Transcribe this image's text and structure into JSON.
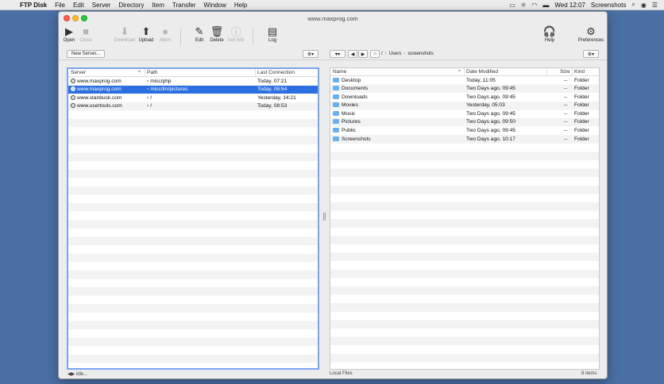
{
  "menubar": {
    "app": "FTP Disk",
    "items": [
      "File",
      "Edit",
      "Server",
      "Directory",
      "Item",
      "Transfer",
      "Window",
      "Help"
    ],
    "clock": "Wed 12:07",
    "user": "Screenshots"
  },
  "window": {
    "title": "www.maxprog.com"
  },
  "toolbar": {
    "open": "Open",
    "close": "Close",
    "download": "Download",
    "upload": "Upload",
    "abort": "Abort",
    "edit": "Edit",
    "delete": "Delete",
    "getinfo": "Get info",
    "log": "Log",
    "help": "Help",
    "preferences": "Preferences"
  },
  "pathbar": {
    "new_server": "New Server...",
    "path": [
      "/",
      "Users",
      "screenshots"
    ]
  },
  "servers": {
    "headers": {
      "server": "Server",
      "path": "Path",
      "last": "Last Connection"
    },
    "rows": [
      {
        "server": "www.maxprog.com",
        "path": "misc/php",
        "last": "Today, 07:21"
      },
      {
        "server": "www.maxprog.com",
        "path": "misc/lm/pictures",
        "last": "Today, 08:54"
      },
      {
        "server": "www.stanbusk.com",
        "path": "/",
        "last": "Yesterday, 14:21"
      },
      {
        "server": "www.usertools.com",
        "path": "/",
        "last": "Today, 08:53"
      }
    ]
  },
  "files": {
    "headers": {
      "name": "Name",
      "date": "Date Modified",
      "size": "Size",
      "kind": "Kind"
    },
    "rows": [
      {
        "name": "Desktop",
        "date": "Today, 11:05",
        "size": "--",
        "kind": "Folder"
      },
      {
        "name": "Documents",
        "date": "Two Days ago, 09:45",
        "size": "--",
        "kind": "Folder"
      },
      {
        "name": "Downloads",
        "date": "Two Days ago, 09:45",
        "size": "--",
        "kind": "Folder"
      },
      {
        "name": "Movies",
        "date": "Yesterday, 05:03",
        "size": "--",
        "kind": "Folder"
      },
      {
        "name": "Music",
        "date": "Two Days ago, 09:45",
        "size": "--",
        "kind": "Folder"
      },
      {
        "name": "Pictures",
        "date": "Two Days ago, 09:50",
        "size": "--",
        "kind": "Folder"
      },
      {
        "name": "Public",
        "date": "Two Days ago, 09:45",
        "size": "--",
        "kind": "Folder"
      },
      {
        "name": "Screenshots",
        "date": "Two Days ago, 10:17",
        "size": "--",
        "kind": "Folder"
      }
    ]
  },
  "status": {
    "left": "idle...",
    "middle": "Local Files",
    "right": "8 items"
  }
}
